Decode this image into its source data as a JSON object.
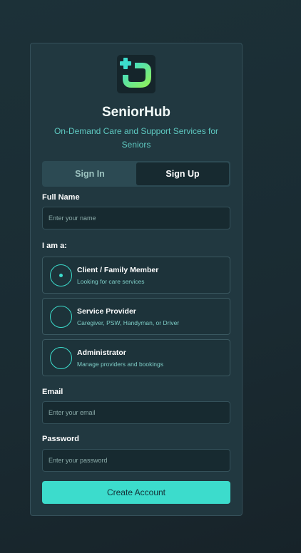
{
  "app": {
    "name": "SeniorHub",
    "tagline": "On-Demand Care and Support Services for Seniors"
  },
  "tabs": [
    {
      "label": "Sign In",
      "active": false
    },
    {
      "label": "Sign Up",
      "active": true
    }
  ],
  "form": {
    "full_name": {
      "label": "Full Name",
      "placeholder": "Enter your name",
      "value": ""
    },
    "role": {
      "label": "I am a:",
      "options": [
        {
          "title": "Client / Family Member",
          "description": "Looking for care services",
          "selected": true
        },
        {
          "title": "Service Provider",
          "description": "Caregiver, PSW, Handyman, or Driver",
          "selected": false
        },
        {
          "title": "Administrator",
          "description": "Manage providers and bookings",
          "selected": false
        }
      ]
    },
    "email": {
      "label": "Email",
      "placeholder": "Enter your email",
      "value": ""
    },
    "password": {
      "label": "Password",
      "placeholder": "Enter your password",
      "value": ""
    },
    "submit_label": "Create Account"
  },
  "colors": {
    "accent": "#3cdccc",
    "logo_green": "#7cf06a",
    "background": "#1c3138",
    "card": "#213840"
  },
  "icons": {
    "logo": "medical-cross-app-icon",
    "radio": "radio-button-icon"
  }
}
